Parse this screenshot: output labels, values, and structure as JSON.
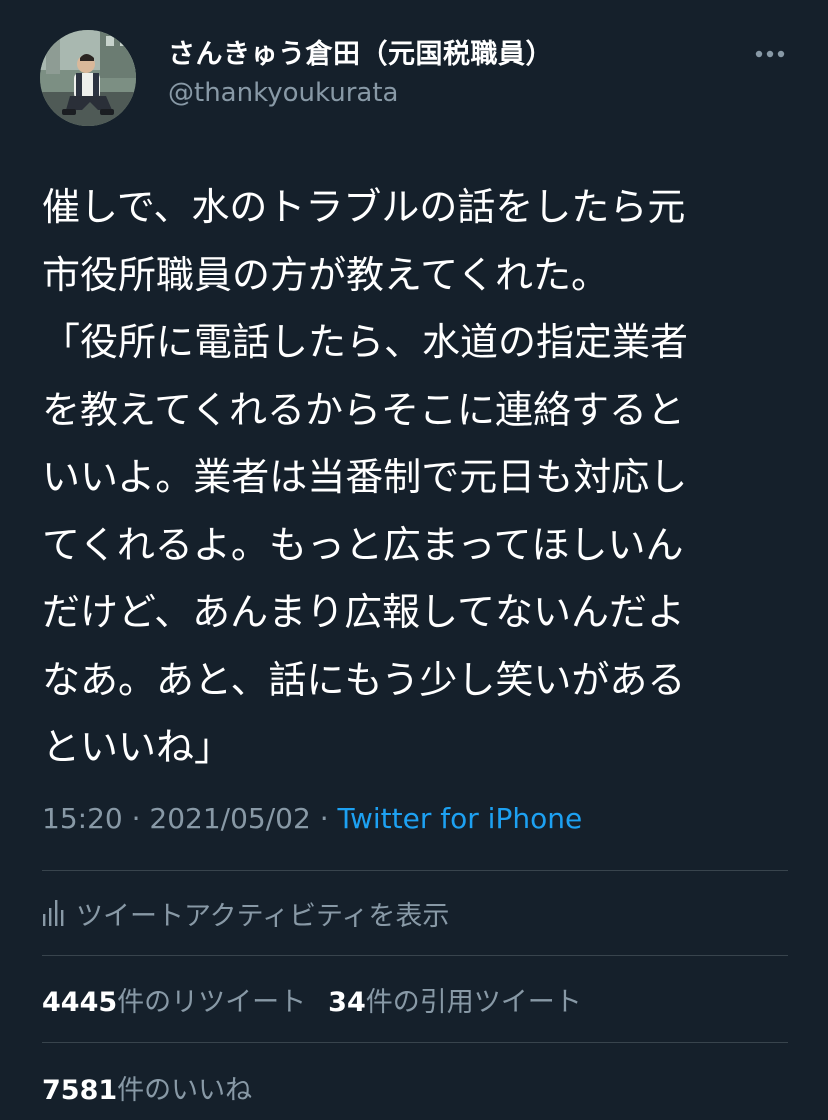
{
  "author": {
    "display_name": "さんきゅう倉田（元国税職員）",
    "handle": "@thankyoukurata"
  },
  "tweet": {
    "text": "催しで、水のトラブルの話をしたら元\n市役所職員の方が教えてくれた。\n「役所に電話したら、水道の指定業者\nを教えてくれるからそこに連絡すると\nいいよ。業者は当番制で元日も対応し\nてくれるよ。もっと広まってほしいん\nだけど、あんまり広報してないんだよ\nなあ。あと、話にもう少し笑いがある\nといいね」",
    "time": "15:20",
    "date": "2021/05/02",
    "separator": "·",
    "source": "Twitter for iPhone"
  },
  "activity": {
    "label": "ツイートアクティビティを表示",
    "icon": "bar-chart-icon"
  },
  "stats": {
    "retweets_count": "4445",
    "retweets_label": "件のリツイート",
    "quotes_count": "34",
    "quotes_label": "件の引用ツイート",
    "likes_count": "7581",
    "likes_label": "件のいいね"
  },
  "icons": {
    "more": "more-horizontal-icon"
  },
  "colors": {
    "background": "#15202b",
    "text_primary": "#ffffff",
    "text_secondary": "#8899a6",
    "accent": "#1da1f2",
    "divider": "#38444d"
  }
}
